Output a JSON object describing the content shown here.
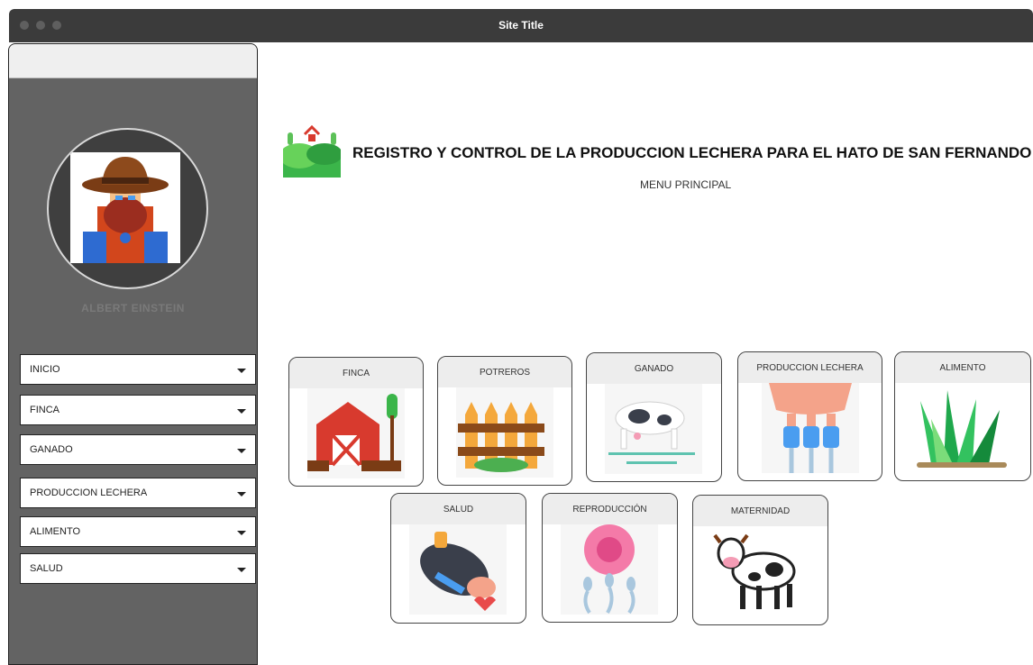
{
  "window": {
    "title": "Site Title"
  },
  "sidebar": {
    "user_name": "ALBERT EINSTEIN",
    "menu": [
      {
        "label": "INICIO"
      },
      {
        "label": "FINCA"
      },
      {
        "label": "GANADO"
      },
      {
        "label": "PRODUCCION LECHERA"
      },
      {
        "label": "ALIMENTO"
      },
      {
        "label": "SALUD"
      }
    ]
  },
  "header": {
    "title": "REGISTRO Y CONTROL DE LA PRODUCCION LECHERA PARA EL HATO DE SAN FERNANDO",
    "subtitle": "MENU PRINCIPAL"
  },
  "cards": [
    {
      "label": "FINCA",
      "icon": "barn-icon"
    },
    {
      "label": "POTREROS",
      "icon": "fence-icon"
    },
    {
      "label": "GANADO",
      "icon": "cow-icon"
    },
    {
      "label": "PRODUCCION LECHERA",
      "icon": "milking-icon"
    },
    {
      "label": "ALIMENTO",
      "icon": "grass-icon"
    },
    {
      "label": "SALUD",
      "icon": "cow-health-icon"
    },
    {
      "label": "REPRODUCCIÓN",
      "icon": "fertilization-icon"
    },
    {
      "label": "MATERNIDAD",
      "icon": "calf-icon"
    }
  ],
  "colors": {
    "titlebar": "#3b3b3b",
    "sidebar": "#636363",
    "card_header": "#ededed"
  }
}
